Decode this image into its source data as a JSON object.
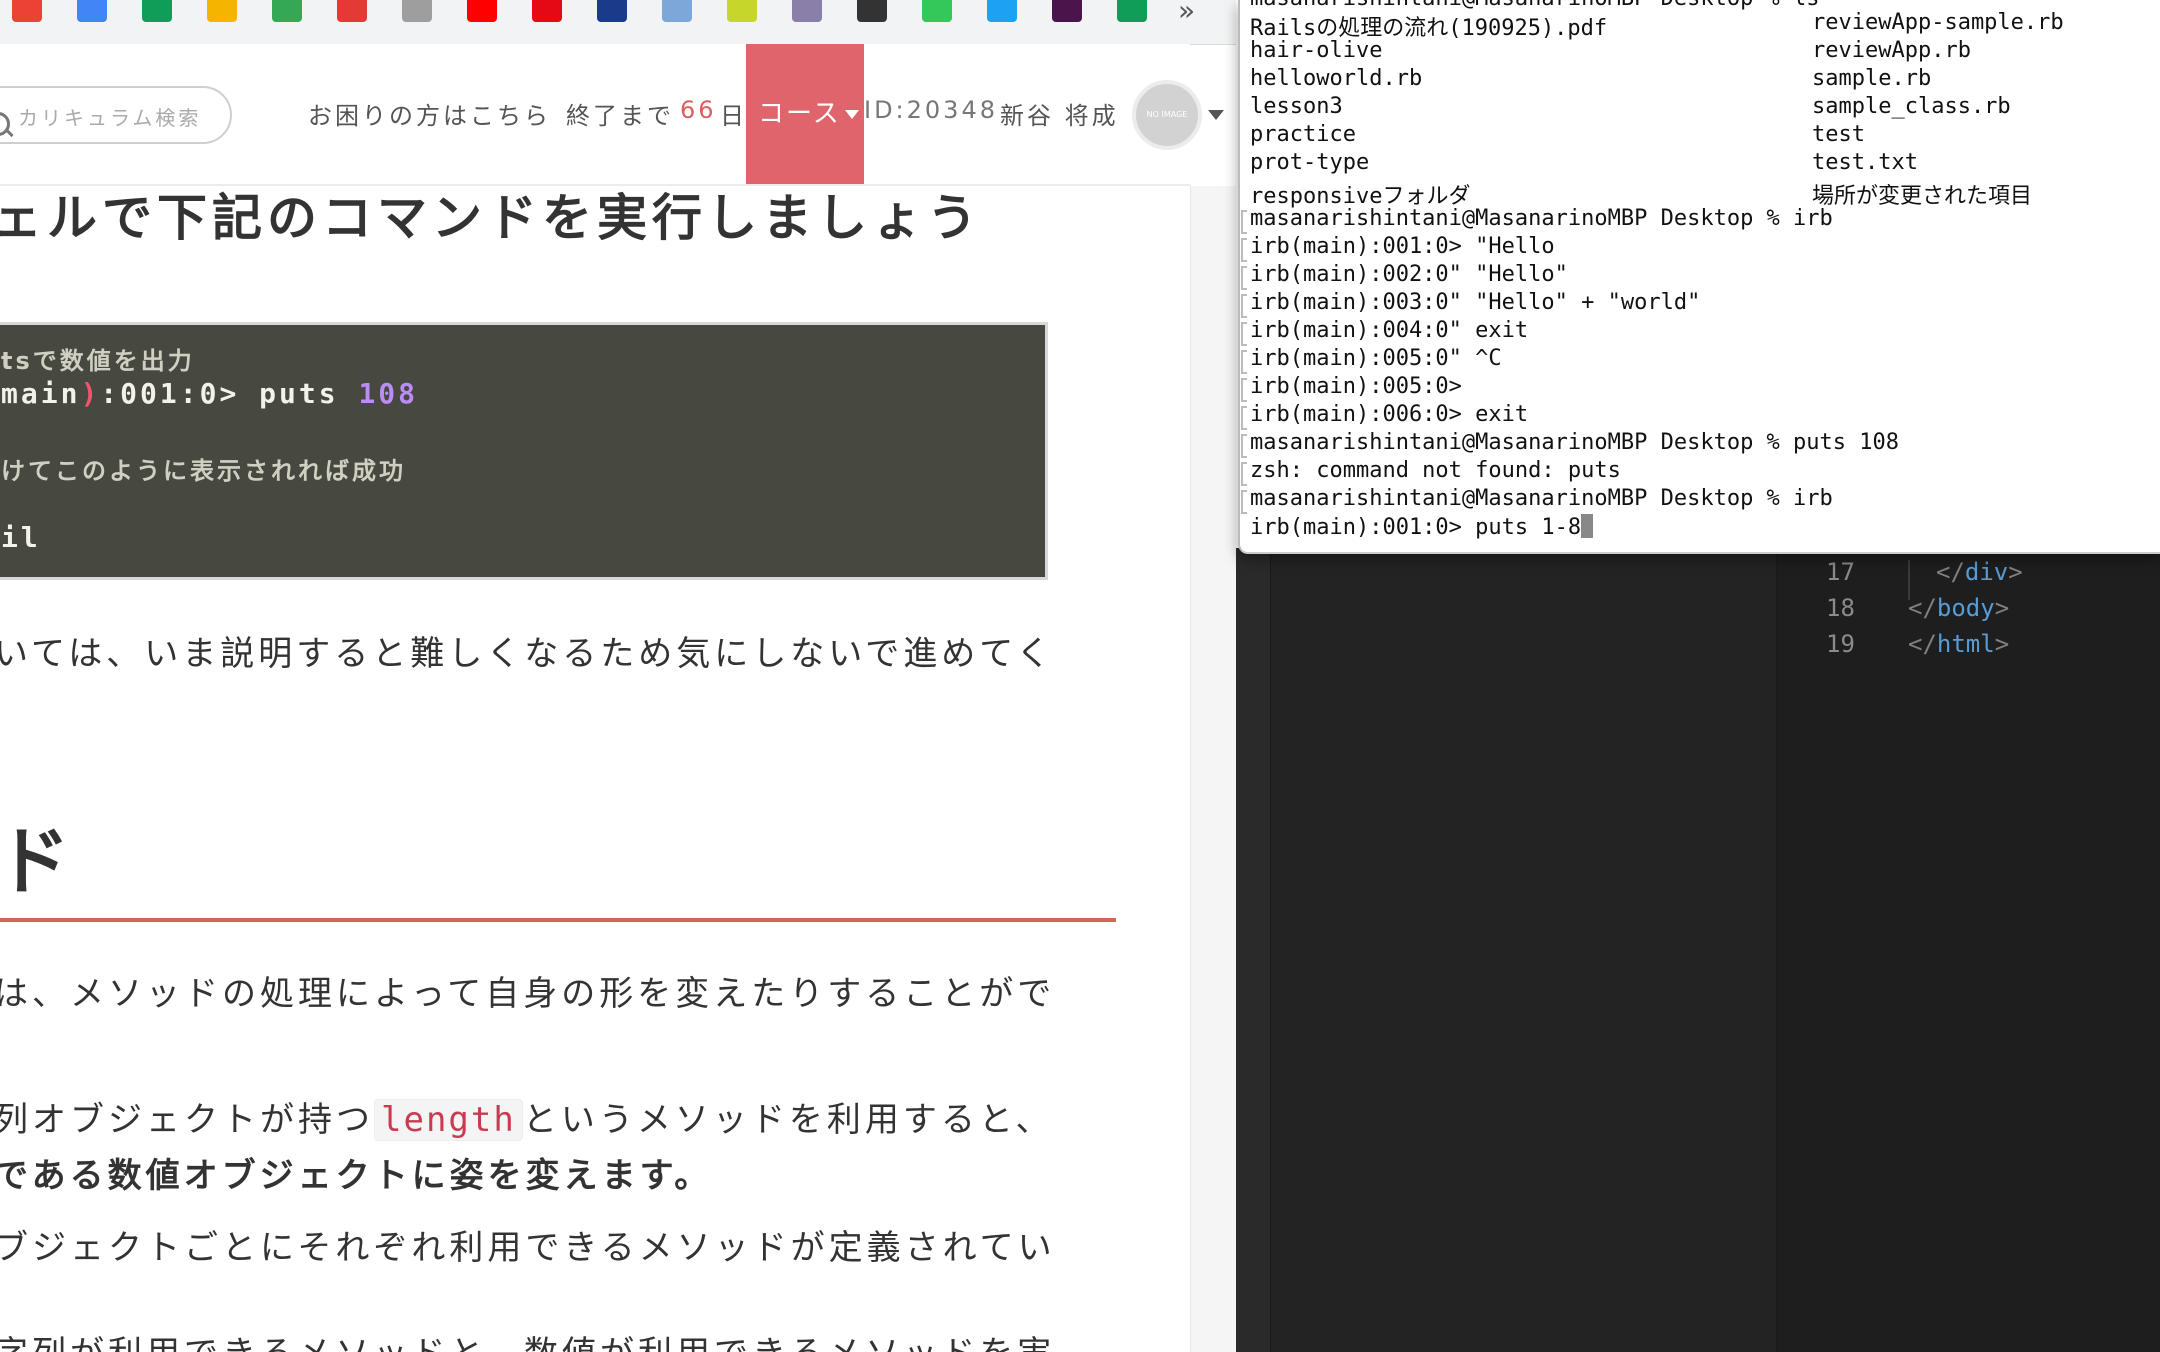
{
  "bookmarks": {
    "items": [
      {
        "name": "gmail",
        "color": "#ea4335"
      },
      {
        "name": "docs",
        "color": "#4285f4"
      },
      {
        "name": "sheets",
        "color": "#0f9d58"
      },
      {
        "name": "slides",
        "color": "#f4b400"
      },
      {
        "name": "maps",
        "color": "#34a853"
      },
      {
        "name": "app-red",
        "color": "#e53935"
      },
      {
        "name": "app-grey",
        "color": "#9e9e9e"
      },
      {
        "name": "youtube",
        "color": "#ff0000"
      },
      {
        "name": "netflix",
        "color": "#e50914"
      },
      {
        "name": "ex",
        "color": "#1a3a8a"
      },
      {
        "name": "in",
        "color": "#7da7d9"
      },
      {
        "name": "app-lime",
        "color": "#c6d62b"
      },
      {
        "name": "app-avatar",
        "color": "#8a7fa8"
      },
      {
        "name": "app-dark",
        "color": "#333333"
      },
      {
        "name": "app-green",
        "color": "#34c759"
      },
      {
        "name": "twitter",
        "color": "#1da1f2"
      },
      {
        "name": "slack",
        "color": "#4a154b"
      },
      {
        "name": "sheets-2",
        "color": "#0f9d58"
      }
    ],
    "more": "»"
  },
  "header": {
    "search_placeholder": "カリキュラム検索",
    "help_link": "お困りの方はこちら",
    "remaining_label": "終了まで",
    "remaining_days": "66",
    "remaining_unit": "日",
    "course_button": "コース",
    "user_id": "ID:20348",
    "user_name": "新谷 将成",
    "avatar_text": "NO IMAGE",
    "accent_color": "#e0646b"
  },
  "content": {
    "heading": "ェルで下記のコマンドを実行しましょう",
    "code": {
      "comment1": "tsで数値を出力",
      "line_prefix": "main",
      "line_paren": ")",
      "line_prompt": ":001:0> puts ",
      "line_num": "108",
      "comment2": "けてこのように表示されれば成功",
      "result": "il"
    },
    "para1": "いては、いま説明すると難しくなるため気にしないで進めてく",
    "method_heading": "ド",
    "para2": "は、メソッドの処理によって自身の形を変えたりすることがで",
    "para3_before": "列オブジェクトが持つ",
    "para3_code": "length",
    "para3_after": "というメソッドを利用すると、",
    "para4": "である数値オブジェクトに姿を変えます。",
    "para5": "ブジェクトごとにそれぞれ利用できるメソッドが定義されてい",
    "para6": "字列が利用できるメソッドと、数値が利用できるメソッドを実"
  },
  "terminal": {
    "top_cut": "masanarishintani@MasanarinoMBP Desktop % ls",
    "ls_left": [
      "Railsの処理の流れ(190925).pdf",
      "hair-olive",
      "helloworld.rb",
      "lesson3",
      "practice",
      "prot-type",
      "responsiveフォルダ"
    ],
    "ls_right": [
      "reviewApp-sample.rb",
      "reviewApp.rb",
      "sample.rb",
      "sample_class.rb",
      "test",
      "test.txt",
      "場所が変更された項目"
    ],
    "lines": [
      "masanarishintani@MasanarinoMBP Desktop % irb",
      "irb(main):001:0> \"Hello",
      "irb(main):002:0\" \"Hello\"",
      "irb(main):003:0\" \"Hello\" + \"world\"",
      "irb(main):004:0\" exit",
      "irb(main):005:0\" ^C",
      "irb(main):005:0>",
      "irb(main):006:0> exit",
      "masanarishintani@MasanarinoMBP Desktop % puts 108",
      "zsh: command not found: puts",
      "masanarishintani@MasanarinoMBP Desktop % irb",
      "irb(main):001:0> puts 1-8"
    ]
  },
  "editor": {
    "lines": [
      {
        "num": "17",
        "open": "</",
        "tag": "div",
        "close": ">"
      },
      {
        "num": "18",
        "open": "</",
        "tag": "body",
        "close": ">"
      },
      {
        "num": "19",
        "open": "</",
        "tag": "html",
        "close": ">"
      }
    ]
  }
}
